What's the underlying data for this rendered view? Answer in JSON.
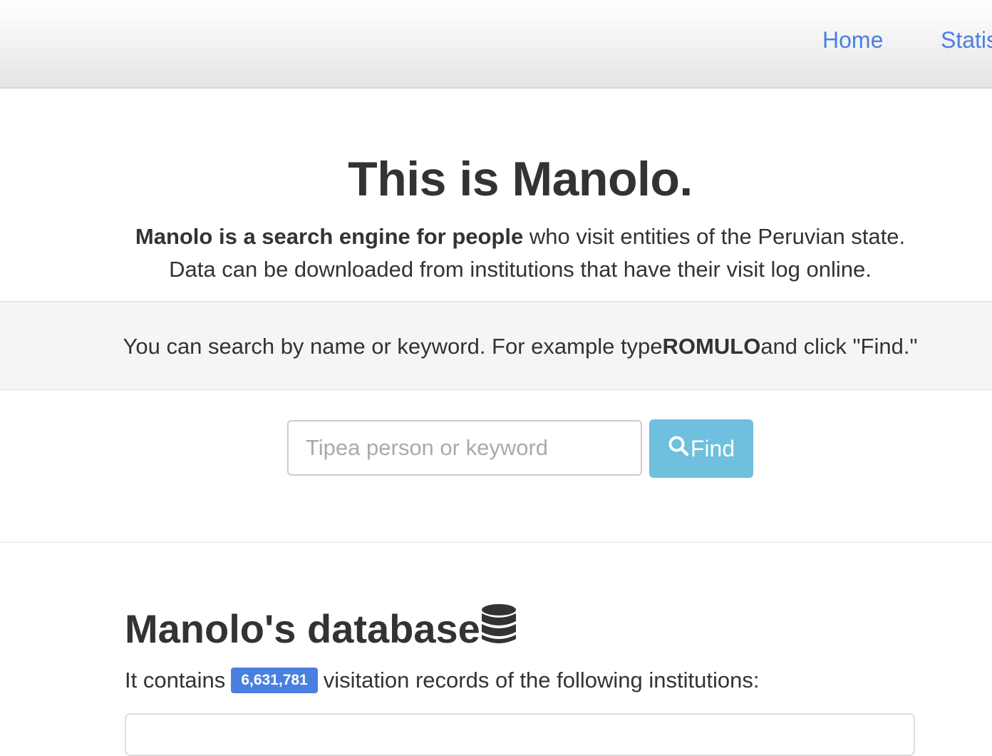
{
  "nav": {
    "items": [
      {
        "label": "Home"
      },
      {
        "label": "Statis"
      }
    ],
    "link_color": "#4a7fe0"
  },
  "hero": {
    "title": "This is Manolo.",
    "line1_bold": "Manolo is a search engine for people",
    "line1_rest": " who visit entities of the Peruvian state.",
    "line2": "Data can be downloaded from institutions that have their visit log online."
  },
  "hint": {
    "before": "You can search by name or keyword. For example type",
    "keyword": "ROMULO",
    "after": "and click \"Find.\""
  },
  "search": {
    "placeholder": "Tipea person or keyword",
    "button_label": "Find",
    "button_icon": "search-icon",
    "button_color": "#6fbfdf"
  },
  "database": {
    "title": "Manolo's database",
    "icon": "database-icon",
    "contains_prefix": "It contains",
    "record_count": "6,631,781",
    "contains_suffix": "visitation records of the following institutions:",
    "badge_color": "#4a7fe0"
  }
}
